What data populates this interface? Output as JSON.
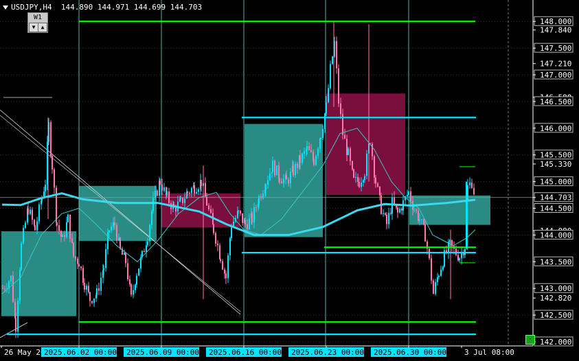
{
  "header": {
    "symbol": "USDJPY,H4",
    "prices": "144.890 144.971 144.699 144.703"
  },
  "timeframe": {
    "label": "W1",
    "down_glyph": "▼",
    "up_glyph": "▲"
  },
  "corner_button": {
    "label": "-"
  },
  "colors": {
    "background": "#000000",
    "bull": "#00e5ff",
    "bear": "#ff79b0",
    "green_line": "#00ff00",
    "cyan_line": "#00e5ff",
    "teal_box": "#2a8a84",
    "maroon_box": "#7a0e3c",
    "ma_thick": "#39d9f0",
    "ma_thin": "#39c6c6"
  },
  "chart_data": {
    "type": "candlestick",
    "symbol": "USDJPY",
    "timeframe": "H4",
    "ylim": [
      142.0,
      148.35
    ],
    "current_price": 144.703,
    "price_scale_labels": [
      "148.000",
      "147.840",
      "147.500",
      "147.210",
      "147.000",
      "146.580",
      "146.500",
      "146.000",
      "145.500",
      "145.330",
      "145.000",
      "144.703",
      "144.500",
      "144.080",
      "144.000",
      "143.500",
      "143.000",
      "142.820",
      "142.500",
      "142.000"
    ],
    "time_labels": [
      "26 May 20",
      "2025.06.02 00:00",
      "2025.06.09 00:00",
      "2025.06.16 00:00",
      "2025.06.23 00:00",
      "2025.06.30 00:00",
      "3 Jul 08:00"
    ],
    "time_label_highlight": [
      false,
      true,
      true,
      true,
      true,
      true,
      false
    ],
    "horizontal_levels": [
      {
        "price": 148.0,
        "color": "green",
        "from": 115,
        "to": 692
      },
      {
        "price": 146.2,
        "color": "cyan",
        "from": 352,
        "to": 693
      },
      {
        "price": 143.77,
        "color": "green",
        "from": 472,
        "to": 693
      },
      {
        "price": 143.67,
        "color": "cyan",
        "from": 352,
        "to": 693
      },
      {
        "price": 142.37,
        "color": "green",
        "from": 115,
        "to": 693
      },
      {
        "price": 142.14,
        "color": "cyan",
        "from": 10,
        "to": 693
      }
    ],
    "zones": [
      {
        "type": "teal",
        "x0": 2,
        "x1": 111,
        "p_top": 144.07,
        "p_bot": 142.48
      },
      {
        "type": "teal",
        "x0": 115,
        "x1": 228,
        "p_top": 144.92,
        "p_bot": 143.89
      },
      {
        "type": "maroon",
        "x0": 235,
        "x1": 350,
        "p_top": 144.78,
        "p_bot": 144.14
      },
      {
        "type": "teal",
        "x0": 356,
        "x1": 470,
        "p_top": 146.08,
        "p_bot": 143.96
      },
      {
        "type": "maroon",
        "x0": 475,
        "x1": 590,
        "p_top": 146.65,
        "p_bot": 144.75
      },
      {
        "type": "teal",
        "x0": 596,
        "x1": 714,
        "p_top": 144.74,
        "p_bot": 144.19
      }
    ],
    "ma_thick": [
      [
        3,
        144.57
      ],
      [
        30,
        144.56
      ],
      [
        60,
        144.69
      ],
      [
        90,
        144.78
      ],
      [
        120,
        144.67
      ],
      [
        170,
        144.6
      ],
      [
        230,
        144.6
      ],
      [
        290,
        144.44
      ],
      [
        330,
        144.2
      ],
      [
        370,
        144.0
      ],
      [
        420,
        144.0
      ],
      [
        470,
        144.15
      ],
      [
        520,
        144.46
      ],
      [
        560,
        144.58
      ],
      [
        600,
        144.55
      ],
      [
        650,
        144.6
      ],
      [
        692,
        144.66
      ]
    ],
    "ma_thin": [
      [
        3,
        142.9
      ],
      [
        30,
        143.2
      ],
      [
        60,
        144.0
      ],
      [
        90,
        144.4
      ],
      [
        115,
        144.5
      ],
      [
        140,
        144.2
      ],
      [
        170,
        143.8
      ],
      [
        200,
        143.5
      ],
      [
        230,
        143.9
      ],
      [
        260,
        144.4
      ],
      [
        290,
        144.7
      ],
      [
        315,
        144.8
      ],
      [
        335,
        144.4
      ],
      [
        355,
        144.1
      ],
      [
        380,
        144.0
      ],
      [
        410,
        144.3
      ],
      [
        440,
        144.8
      ],
      [
        470,
        145.3
      ],
      [
        495,
        145.9
      ],
      [
        520,
        146.0
      ],
      [
        545,
        145.6
      ],
      [
        570,
        145.0
      ],
      [
        590,
        144.7
      ],
      [
        610,
        144.5
      ],
      [
        630,
        144.0
      ],
      [
        660,
        143.8
      ],
      [
        680,
        143.95
      ],
      [
        692,
        144.1
      ]
    ],
    "candle_path": [
      [
        3,
        143.0
      ],
      [
        15,
        143.2
      ],
      [
        22,
        142.3
      ],
      [
        30,
        143.8
      ],
      [
        40,
        144.5
      ],
      [
        50,
        144.1
      ],
      [
        60,
        144.7
      ],
      [
        65,
        145.0
      ],
      [
        70,
        146.05
      ],
      [
        75,
        145.3
      ],
      [
        82,
        144.2
      ],
      [
        90,
        143.9
      ],
      [
        98,
        144.3
      ],
      [
        106,
        143.6
      ],
      [
        114,
        143.5
      ],
      [
        122,
        143.1
      ],
      [
        130,
        142.8
      ],
      [
        140,
        142.9
      ],
      [
        150,
        143.4
      ],
      [
        158,
        144.1
      ],
      [
        166,
        144.2
      ],
      [
        174,
        143.7
      ],
      [
        182,
        143.5
      ],
      [
        190,
        142.8
      ],
      [
        198,
        143.3
      ],
      [
        206,
        143.6
      ],
      [
        214,
        144.0
      ],
      [
        222,
        144.6
      ],
      [
        232,
        145.0
      ],
      [
        242,
        144.7
      ],
      [
        252,
        144.5
      ],
      [
        262,
        144.6
      ],
      [
        272,
        144.8
      ],
      [
        282,
        144.9
      ],
      [
        292,
        145.0
      ],
      [
        300,
        144.6
      ],
      [
        310,
        144.1
      ],
      [
        320,
        143.6
      ],
      [
        328,
        143.2
      ],
      [
        336,
        144.2
      ],
      [
        346,
        144.4
      ],
      [
        356,
        144.2
      ],
      [
        366,
        144.3
      ],
      [
        376,
        144.7
      ],
      [
        386,
        145.0
      ],
      [
        396,
        145.3
      ],
      [
        406,
        145.1
      ],
      [
        416,
        145.0
      ],
      [
        426,
        145.2
      ],
      [
        436,
        145.4
      ],
      [
        446,
        145.6
      ],
      [
        456,
        145.4
      ],
      [
        466,
        145.9
      ],
      [
        474,
        146.4
      ],
      [
        480,
        147.1
      ],
      [
        486,
        147.6
      ],
      [
        492,
        146.5
      ],
      [
        498,
        145.9
      ],
      [
        506,
        145.5
      ],
      [
        514,
        145.0
      ],
      [
        522,
        145.0
      ],
      [
        530,
        145.2
      ],
      [
        538,
        145.8
      ],
      [
        546,
        145.0
      ],
      [
        554,
        144.5
      ],
      [
        562,
        144.2
      ],
      [
        570,
        144.6
      ],
      [
        578,
        144.4
      ],
      [
        586,
        144.6
      ],
      [
        594,
        144.8
      ],
      [
        602,
        144.5
      ],
      [
        610,
        144.3
      ],
      [
        618,
        144.0
      ],
      [
        624,
        143.5
      ],
      [
        630,
        142.9
      ],
      [
        638,
        143.3
      ],
      [
        646,
        143.6
      ],
      [
        654,
        143.8
      ],
      [
        660,
        143.7
      ],
      [
        668,
        143.6
      ],
      [
        676,
        143.8
      ],
      [
        680,
        144.9
      ],
      [
        686,
        145.0
      ],
      [
        691,
        144.7
      ]
    ]
  }
}
